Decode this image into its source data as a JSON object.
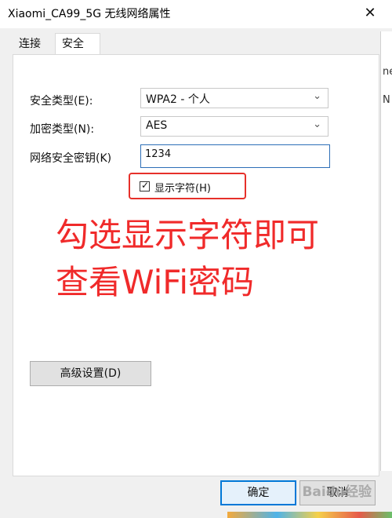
{
  "window": {
    "title": "Xiaomi_CA99_5G 无线网络属性",
    "close_glyph": "✕"
  },
  "tabs": [
    {
      "label": "连接"
    },
    {
      "label": "安全"
    }
  ],
  "background": {
    "fragment_1": "ne",
    "fragment_2": "N"
  },
  "security": {
    "type_label": "安全类型(E):",
    "type_value": "WPA2 - 个人",
    "encryption_label": "加密类型(N):",
    "encryption_value": "AES",
    "key_label": "网络安全密钥(K)",
    "key_value": "1234",
    "show_chars_label": "显示字符(H)",
    "show_chars_checked": true,
    "checkbox_glyph": "✓",
    "dropdown_icon": "⌄"
  },
  "annotation": {
    "line1": "勾选显示字符即可",
    "line2": "查看WiFi密码",
    "color": "#f02a2a"
  },
  "buttons": {
    "advanced": "高级设置(D)",
    "ok": "确定",
    "cancel": "取消"
  },
  "watermark": "Baidu经验",
  "colors": {
    "accent": "#0078d7",
    "highlight_red": "#e6302a"
  }
}
